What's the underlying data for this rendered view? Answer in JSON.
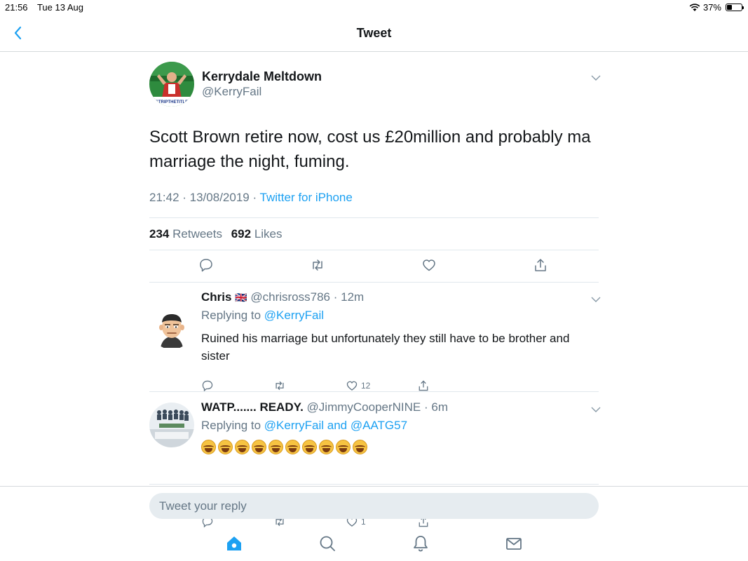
{
  "status_bar": {
    "time": "21:56",
    "date": "Tue 13 Aug",
    "battery": "37%",
    "battery_level": 0.37
  },
  "nav": {
    "title": "Tweet",
    "back_icon": "chevron-left-icon"
  },
  "tweet": {
    "author_name": "Kerrydale Meltdown",
    "author_handle": "@KerryFail",
    "avatar_caption": "STRIPTHETITLE",
    "text": "Scott Brown retire now, cost us £20million and probably ma marriage the night, fuming.",
    "timestamp": "21:42 · 13/08/2019 · ",
    "source": "Twitter for iPhone",
    "retweets_count": "234",
    "retweets_label": "Retweets",
    "likes_count": "692",
    "likes_label": "Likes"
  },
  "replies": [
    {
      "name": "Chris",
      "flag": "🇬🇧",
      "handle": "@chrisross786 · 12m",
      "replying_prefix": "Replying to ",
      "replying_to": "@KerryFail",
      "text": "Ruined his marriage but unfortunately they still have to be brother and sister",
      "like_count": "12"
    },
    {
      "name": "WATP....... READY.",
      "handle": "@JimmyCooperNINE · 6m",
      "replying_prefix": "Replying to ",
      "replying_to": "@KerryFail and @AATG57",
      "text": "😂😂😂😂😂😂😂😂😂😂",
      "emoji_count": 10,
      "like_count": "1"
    }
  ],
  "compose": {
    "placeholder": "Tweet your reply"
  },
  "colors": {
    "accent": "#1da1f2",
    "secondary_text": "#657786",
    "divider": "#e1e8ed"
  },
  "tabs": [
    "home-icon",
    "search-icon",
    "notifications-icon",
    "messages-icon"
  ]
}
